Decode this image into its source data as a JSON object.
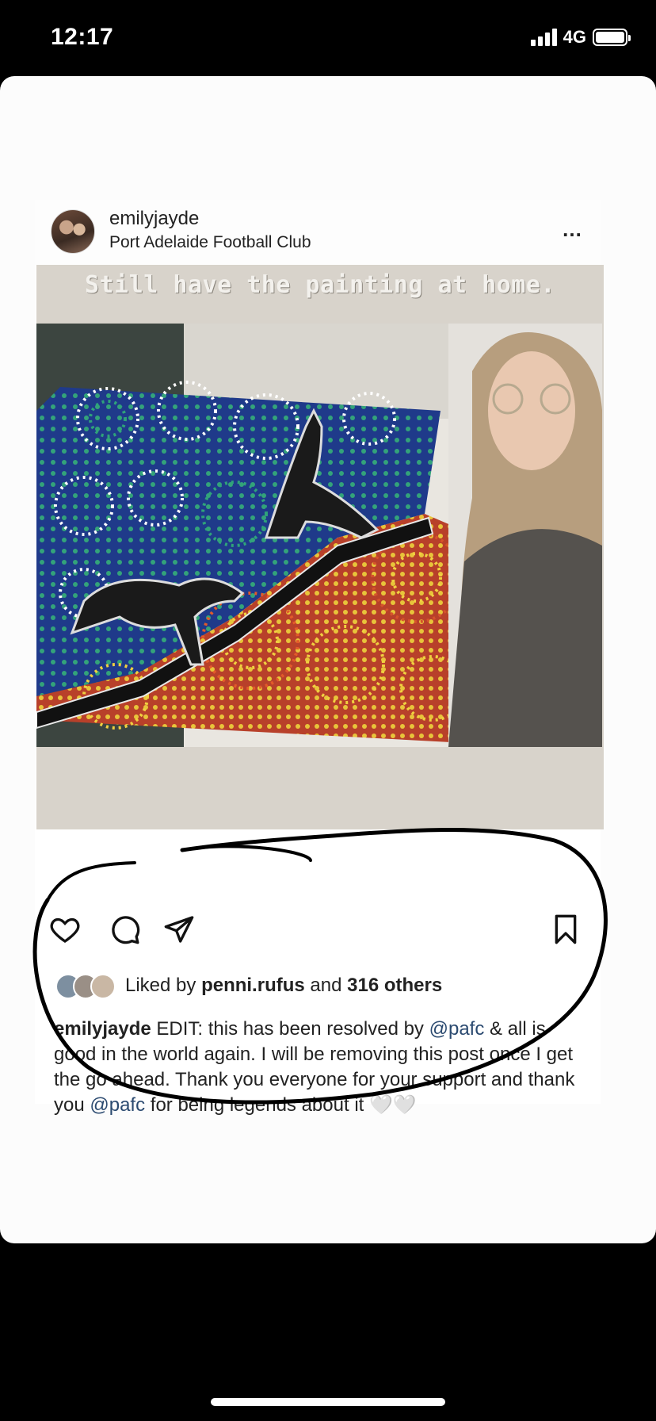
{
  "status_bar": {
    "time": "12:17",
    "network": "4G"
  },
  "post": {
    "username": "emilyjayde",
    "location": "Port Adelaide Football Club",
    "more_icon": "…",
    "image_caption": "Still have the painting at home.",
    "likes": {
      "prefix": "Liked by",
      "user": "penni.rufus",
      "conjunction": "and",
      "others": "316 others"
    },
    "caption": {
      "user": "emilyjayde",
      "part1": "EDIT: this has been resolved by",
      "mention1": "@pafc",
      "part2": "& all is good in the world again. I will be removing this post once I get the go ahead. Thank you everyone for your support and thank you",
      "mention2": "@pafc",
      "part3": "for being legends about it",
      "emoji": "🤍🤍"
    }
  },
  "colors": {
    "mention": "#2b4a70",
    "scribble": "#000000"
  }
}
